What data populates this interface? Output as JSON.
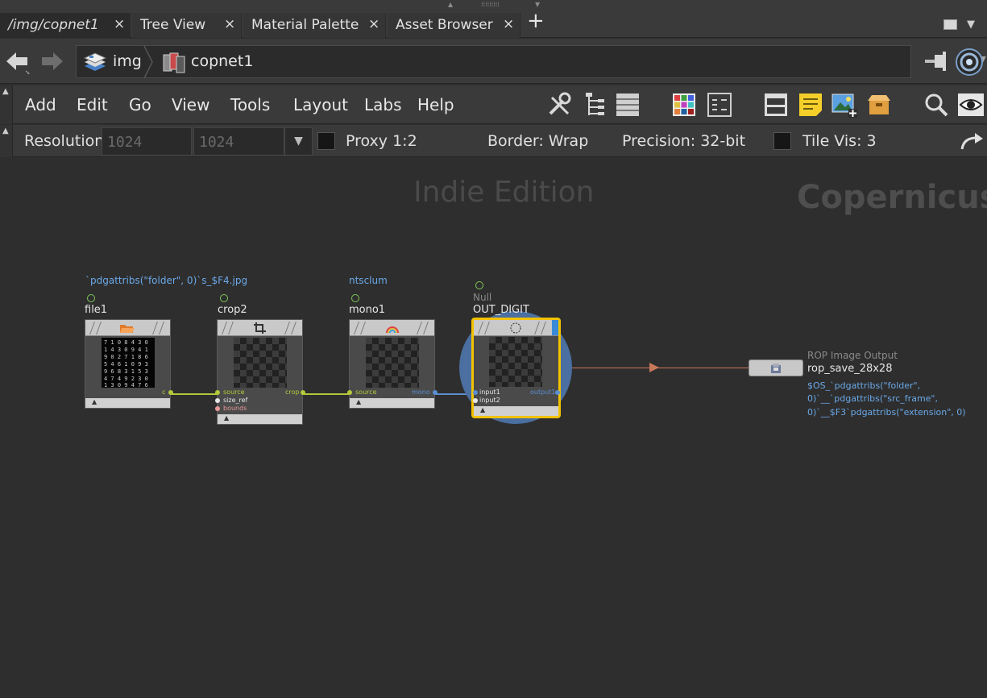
{
  "tabs": [
    {
      "label": "/img/copnet1",
      "active": true
    },
    {
      "label": "Tree View",
      "active": false
    },
    {
      "label": "Material Palette",
      "active": false
    },
    {
      "label": "Asset Browser",
      "active": false
    }
  ],
  "tab_close_glyph": "×",
  "tab_add_glyph": "+",
  "path": {
    "crumbs": [
      {
        "label": "img",
        "icon": "image-network-icon"
      },
      {
        "label": "copnet1",
        "icon": "copernicus-network-icon"
      }
    ]
  },
  "menu": [
    "Add",
    "Edit",
    "Go",
    "View",
    "Tools",
    "Layout",
    "Labs",
    "Help"
  ],
  "toolbar_icons": [
    "tools-icon",
    "tree-layout-icon",
    "list-icon",
    "color-palette-icon",
    "parameter-grid-icon",
    "network-box-icon",
    "sticky-note-icon",
    "image-add-icon",
    "subnet-box-icon",
    "search-icon",
    "eye-icon"
  ],
  "options": {
    "resolution_label": "Resolution",
    "res_x": "1024",
    "res_y": "1024",
    "proxy_label": "Proxy 1:2",
    "border_label": "Border: Wrap",
    "precision_label": "Precision: 32-bit",
    "tile_label": "Tile Vis: 3"
  },
  "watermarks": {
    "edition": "Indie Edition",
    "context": "Copernicus"
  },
  "nodes": [
    {
      "name": "file1",
      "comment": "`pdgattribs(\"folder\", 0)`s_$F4.jpg",
      "outputs": [
        "c"
      ],
      "inputs": []
    },
    {
      "name": "crop2",
      "inputs": [
        "source",
        "size_ref",
        "bounds"
      ],
      "outputs": [
        "crop"
      ]
    },
    {
      "name": "mono1",
      "comment": "ntsclum",
      "inputs": [
        "source"
      ],
      "outputs": [
        "mono"
      ]
    },
    {
      "name": "OUT_DIGIT",
      "type": "Null",
      "inputs": [
        "input1",
        "input2"
      ],
      "outputs": [
        "output1"
      ],
      "selected": true
    },
    {
      "name": "rop_save_28x28",
      "type": "ROP Image Output",
      "comment_lines": [
        "$OS_`pdgattribs(\"folder\",",
        "0)`__`pdgattribs(\"src_frame\",",
        "0)`__$F3`pdgattribs(\"extension\", 0)"
      ]
    }
  ],
  "colors": {
    "accent_selected": "#f2c200",
    "wire_green": "#b4c83a",
    "wire_blue": "#5a8ed0",
    "wire_orange": "#c8785a",
    "comment_blue": "#6aa8e8"
  }
}
